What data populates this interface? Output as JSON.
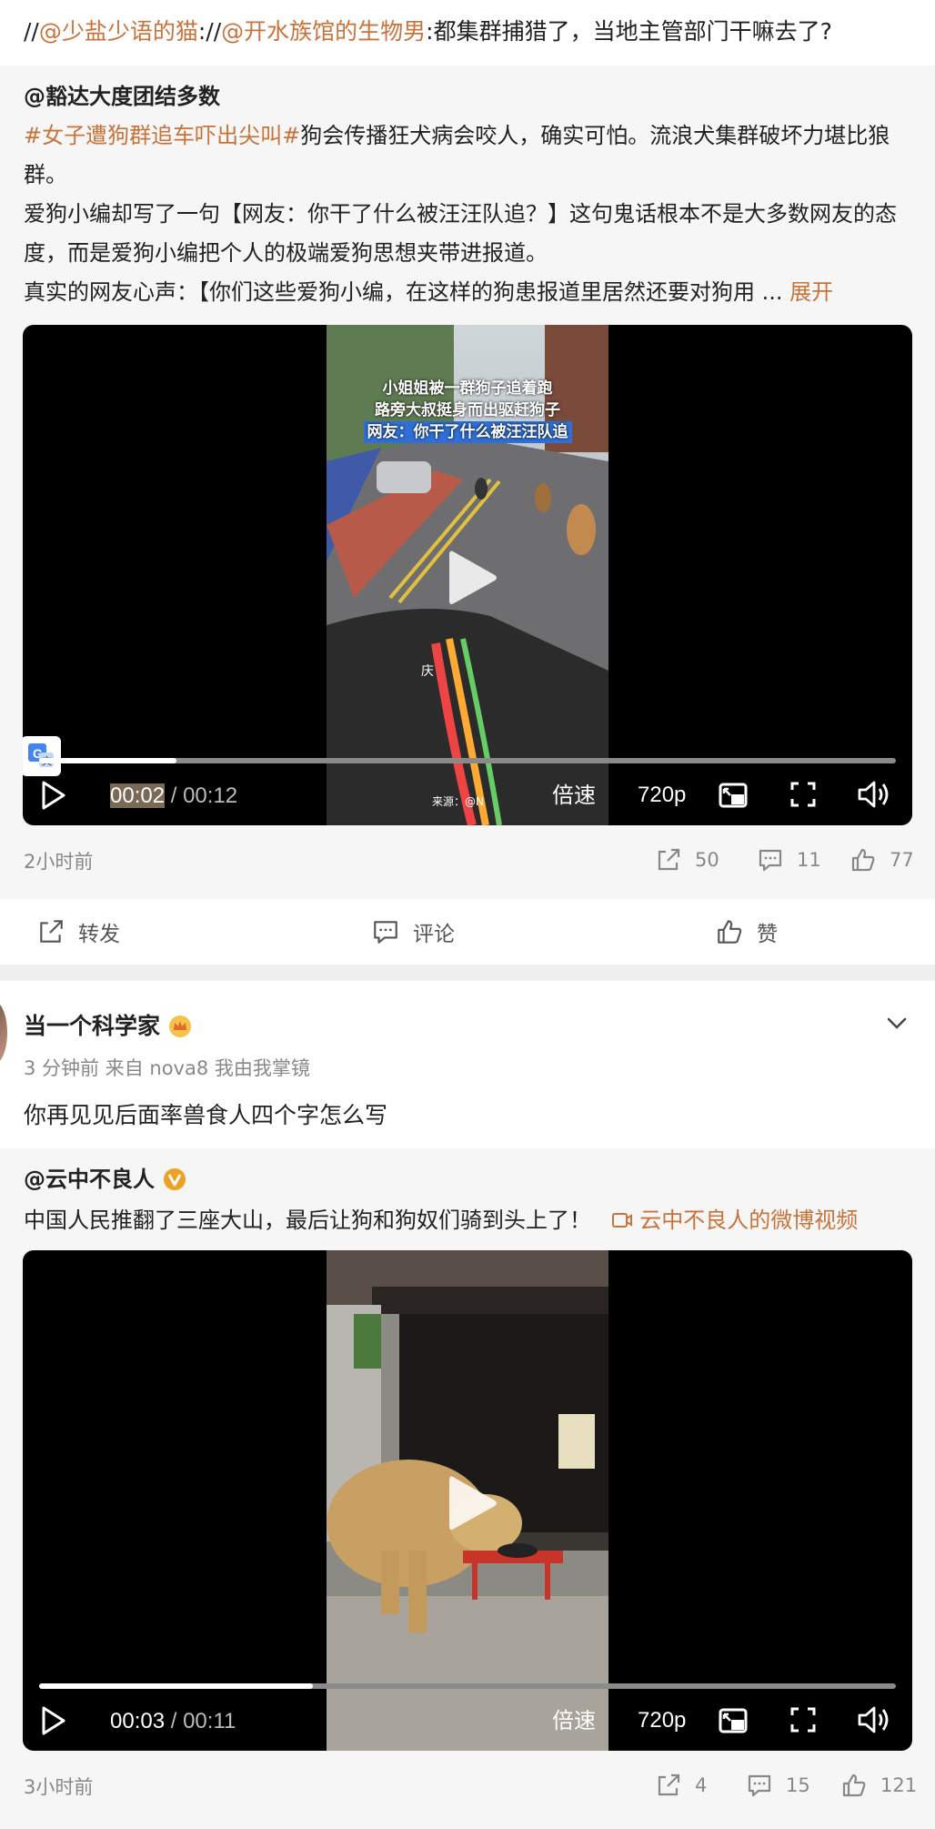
{
  "repost_chain": {
    "prefix1": "//",
    "user1": "@少盐少语的猫",
    "sep": "://",
    "user2": "@开水族馆的生物男",
    "text": ":都集群捕猎了，当地主管部门干嘛去了?"
  },
  "post1": {
    "author": "@豁达大度团结多数",
    "hashtag": "#女子遭狗群追车吓出尖叫#",
    "line1_rest": "狗会传播狂犬病会咬人，确实可怕。流浪犬集群破坏力堪比狼群。",
    "line2": "爱狗小编却写了一句【网友：你干了什么被汪汪队追？】这句鬼话根本不是大多数网友的态度，而是爱狗小编把个人的极端爱狗思想夹带进报道。",
    "line3": "真实的网友心声：【你们这些爱狗小编，在这样的狗患报道里居然还要对狗用",
    "ellipsis": "...",
    "expand": "展开",
    "video": {
      "caption1": "小姐姐被一群狗子追着跑",
      "caption2": "路旁大叔挺身而出驱赶狗子",
      "caption3": "网友：你干了什么被汪汪队追",
      "watermark": "来源：@N",
      "bead": "庆",
      "time_current": "00:02",
      "time_sep": " / ",
      "time_total": "00:12",
      "progress": 0.16,
      "speed": "倍速",
      "quality": "720p"
    },
    "time_ago": "2小时前",
    "shares": "50",
    "comments": "11",
    "likes": "77"
  },
  "action_bar": {
    "repost": "转发",
    "comment": "评论",
    "like": "赞"
  },
  "post2": {
    "user_name": "当一个科学家",
    "meta": "3 分钟前  来自 nova8 我由我掌镜",
    "body": "你再见见后面率兽食人四个字怎么写"
  },
  "post3": {
    "author": "@云中不良人",
    "text": "中国人民推翻了三座大山，最后让狗和狗奴们骑到头上了！",
    "video_link": "云中不良人的微博视频",
    "video": {
      "time_current": "00:03",
      "time_sep": " / ",
      "time_total": "00:11",
      "progress": 0.32,
      "speed": "倍速",
      "quality": "720p"
    },
    "time_ago": "3小时前",
    "shares": "4",
    "comments": "15",
    "likes": "121"
  },
  "colors": {
    "link": "#c9733b",
    "gold_badge": "#f0a020"
  }
}
